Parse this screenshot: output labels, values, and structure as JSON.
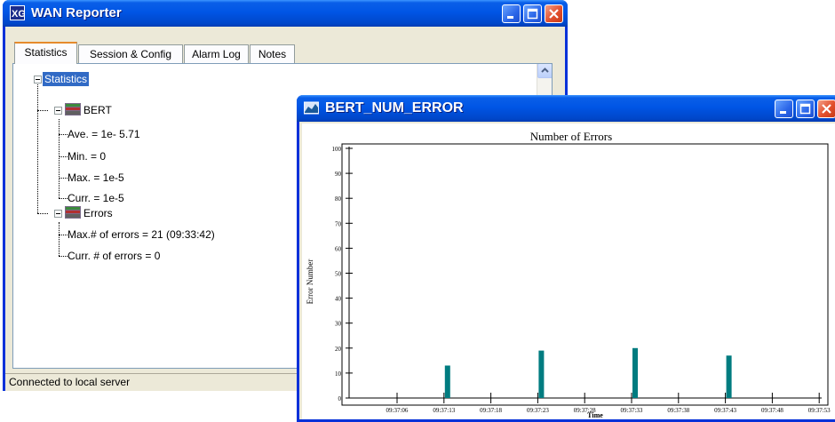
{
  "wan_window": {
    "title": "WAN Reporter",
    "tabs": [
      "Statistics",
      "Session & Config",
      "Alarm Log",
      "Notes"
    ],
    "tree": {
      "root": "Statistics",
      "bert": {
        "label": "BERT",
        "items": [
          "Ave. = 1e- 5.71",
          "Min. = 0",
          "Max. = 1e-5",
          "Curr. = 1e-5"
        ]
      },
      "errors": {
        "label": "Errors",
        "items": [
          "Max.# of errors = 21 (09:33:42)",
          "Curr. # of errors = 0"
        ]
      }
    },
    "status": "Connected to local server"
  },
  "chart_window": {
    "title": "BERT_NUM_ERROR"
  },
  "chart_data": {
    "type": "bar",
    "title": "Number of Errors",
    "xlabel": "Time",
    "ylabel": "Error Number",
    "ylim": [
      0,
      100
    ],
    "yticks": [
      0,
      10,
      20,
      30,
      40,
      50,
      60,
      70,
      80,
      90,
      100
    ],
    "xticks": [
      "09:37:06",
      "09:37:13",
      "09:37:18",
      "09:37:23",
      "09:37:28",
      "09:37:33",
      "09:37:38",
      "09:37:43",
      "09:37:48",
      "09:37:53"
    ],
    "bars": [
      {
        "x": "09:37:13",
        "value": 13
      },
      {
        "x": "09:37:23",
        "value": 19
      },
      {
        "x": "09:37:33",
        "value": 20
      },
      {
        "x": "09:37:43",
        "value": 17
      }
    ],
    "bar_color": "#007c80",
    "grid": false
  }
}
